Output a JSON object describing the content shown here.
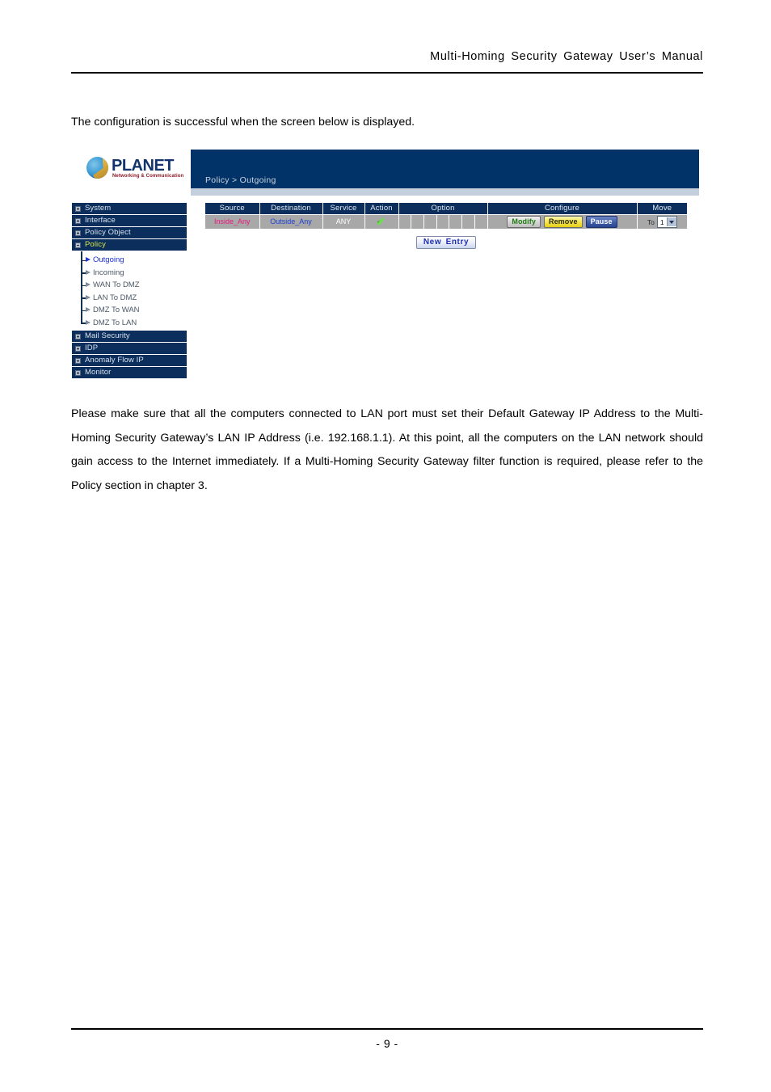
{
  "document": {
    "running_header": "Multi-Homing  Security  Gateway  User’s  Manual",
    "intro_text": "The configuration is successful when the screen below is displayed.",
    "body_paragraph": "Please make sure that all the computers connected to LAN port must set their Default Gateway IP Address to the Multi-Homing Security Gateway’s LAN IP Address (i.e. 192.168.1.1). At this point, all the computers on the LAN network should gain access to the Internet immediately. If a Multi-Homing Security Gateway filter function is required, please refer to the Policy section in chapter 3.",
    "page_number": "- 9 -"
  },
  "screenshot": {
    "logo": {
      "wordmark": "PLANET",
      "tagline": "Networking & Communication"
    },
    "breadcrumb": "Policy > Outgoing",
    "sidebar": {
      "top_items": [
        {
          "label": "System",
          "expander": "plus",
          "active": false
        },
        {
          "label": "Interface",
          "expander": "plus",
          "active": false
        },
        {
          "label": "Policy Object",
          "expander": "plus",
          "active": false
        },
        {
          "label": "Policy",
          "expander": "minus",
          "active": true
        }
      ],
      "sub_items": [
        {
          "label": "Outgoing",
          "selected": true
        },
        {
          "label": "Incoming",
          "selected": false
        },
        {
          "label": "WAN To DMZ",
          "selected": false
        },
        {
          "label": "LAN To DMZ",
          "selected": false
        },
        {
          "label": "DMZ To WAN",
          "selected": false
        },
        {
          "label": "DMZ To LAN",
          "selected": false
        }
      ],
      "bottom_items": [
        {
          "label": "Mail Security",
          "expander": "plus",
          "active": false
        },
        {
          "label": "IDP",
          "expander": "plus",
          "active": false
        },
        {
          "label": "Anomaly Flow IP",
          "expander": "plus",
          "active": false
        },
        {
          "label": "Monitor",
          "expander": "plus",
          "active": false
        }
      ]
    },
    "policy_table": {
      "columns": [
        "Source",
        "Destination",
        "Service",
        "Action",
        "Option",
        "Configure",
        "Move"
      ],
      "option_subcell_count": 7,
      "rows": [
        {
          "source": "Inside_Any",
          "destination": "Outside_Any",
          "service": "ANY",
          "action_icon": "green-check-icon",
          "option_values": [
            "",
            "",
            "",
            "",
            "",
            "",
            ""
          ],
          "configure": {
            "modify_label": "Modify",
            "remove_label": "Remove",
            "pause_label": "Pause"
          },
          "move": {
            "prefix_label": "To",
            "selected_value": "1"
          }
        }
      ]
    },
    "new_entry_label": "New  Entry",
    "colors": {
      "banner_navy": "#023368",
      "sidebar_navy": "#0b2e5c",
      "table_header_navy": "#0b2e5c",
      "row_gray": "#a8a8a8",
      "source_pink": "#e8197f",
      "destination_blue": "#1e3fd0",
      "active_menu_yellow": "#d7e34a",
      "selected_link_blue": "#1a2fd0",
      "check_green": "#6ede4c",
      "modify_green": "#1f7a10",
      "remove_yellow": "#f3e24c",
      "pause_blue": "#3f5ca8",
      "new_entry_blue": "#1c2fb4",
      "strip_bluegray": "#c3cfdc"
    }
  }
}
